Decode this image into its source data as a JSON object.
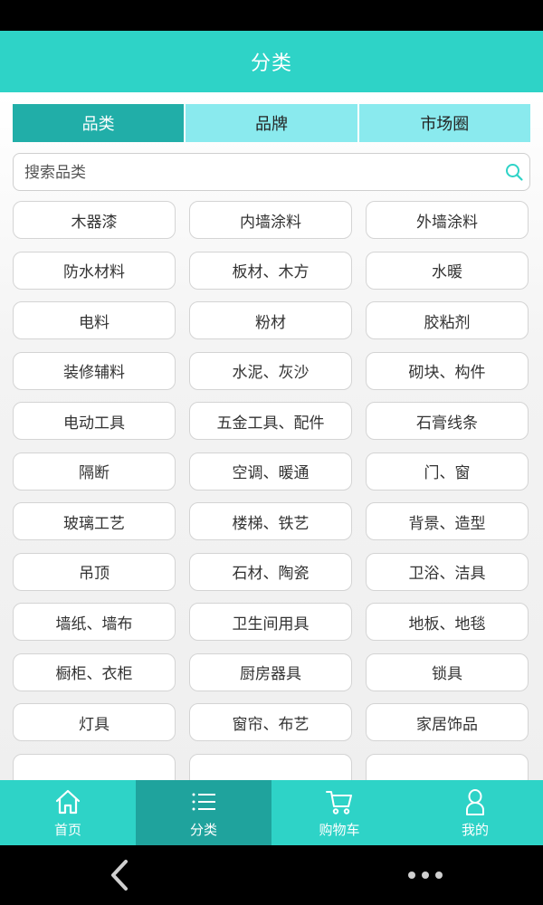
{
  "header": {
    "title": "分类"
  },
  "tabs": [
    {
      "label": "品类",
      "active": true
    },
    {
      "label": "品牌",
      "active": false
    },
    {
      "label": "市场圈",
      "active": false
    }
  ],
  "search": {
    "placeholder": "搜索品类",
    "icon": "search-icon"
  },
  "categories": [
    "木器漆",
    "内墙涂料",
    "外墙涂料",
    "防水材料",
    "板材、木方",
    "水暖",
    "电料",
    "粉材",
    "胶粘剂",
    "装修辅料",
    "水泥、灰沙",
    "砌块、构件",
    "电动工具",
    "五金工具、配件",
    "石膏线条",
    "隔断",
    "空调、暖通",
    "门、窗",
    "玻璃工艺",
    "楼梯、铁艺",
    "背景、造型",
    "吊顶",
    "石材、陶瓷",
    "卫浴、洁具",
    "墙纸、墙布",
    "卫生间用具",
    "地板、地毯",
    "橱柜、衣柜",
    "厨房器具",
    "锁具",
    "灯具",
    "窗帘、布艺",
    "家居饰品"
  ],
  "bottom_nav": [
    {
      "label": "首页",
      "icon": "home-icon",
      "active": false
    },
    {
      "label": "分类",
      "icon": "list-icon",
      "active": true
    },
    {
      "label": "购物车",
      "icon": "cart-icon",
      "active": false
    },
    {
      "label": "我的",
      "icon": "user-icon",
      "active": false
    }
  ],
  "colors": {
    "header": "#2ed3c7",
    "tab_active": "#21aea8",
    "tab_inactive": "#8aeaee",
    "nav_active": "#1fa39d"
  }
}
